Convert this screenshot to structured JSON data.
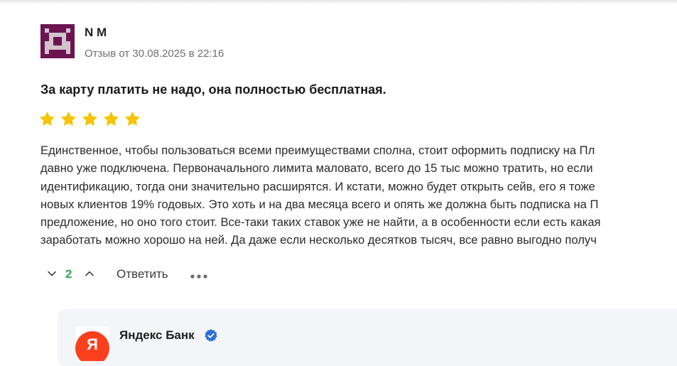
{
  "review": {
    "author": "N M",
    "date": "Отзыв от 30.08.2025 в 22:16",
    "title": "За карту платить не надо, она полностью бесплатная.",
    "rating": 5,
    "rating_max": 5,
    "star_color": "#f6c400",
    "body_lines": [
      "Единственное, чтобы пользоваться всеми преимуществами сполна, стоит оформить подписку на Пл",
      "давно уже подключена. Первоначального лимита маловато, всего до 15 тыс можно тратить, но если",
      "идентификацию, тогда они значительно расширятся. И кстати, можно будет открыть сейв, его я тоже",
      "новых клиентов 19% годовых. Это хоть и на два месяца всего и опять же должна быть подписка на П",
      "предложение, но оно того стоит. Все-таки таких ставок уже не найти, а в особенности если есть какая",
      "заработать можно хорошо на ней. Да даже если несколько десятков тысяч, все равно выгодно получ"
    ]
  },
  "actions": {
    "vote_count": "2",
    "vote_color": "#2aa84a",
    "reply_label": "Ответить",
    "down_icon": "chevron-down-icon",
    "up_icon": "chevron-up-icon",
    "more_icon": "more-dots-icon"
  },
  "bank_reply": {
    "name": "Яндекс Банк",
    "logo_letter": "Я",
    "logo_color": "#fc3f1d",
    "verified_color": "#2f6fd8"
  }
}
